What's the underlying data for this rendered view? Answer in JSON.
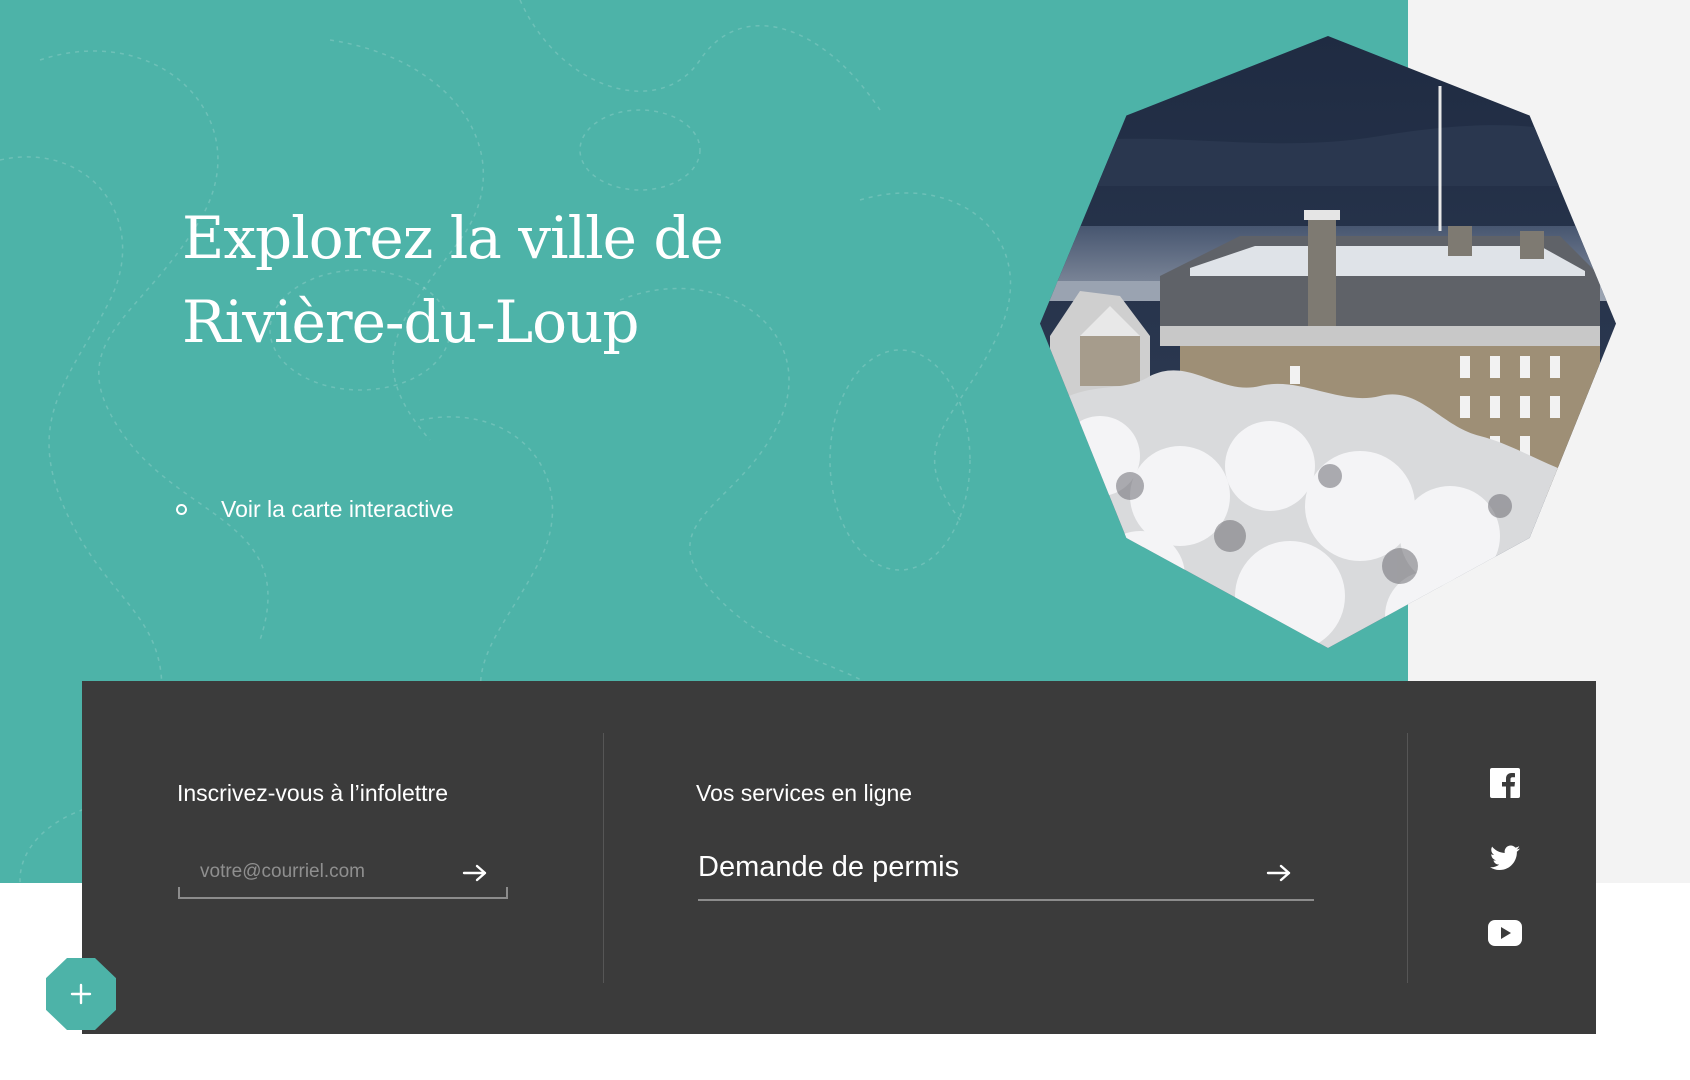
{
  "hero": {
    "title_line1": "Explorez la ville de",
    "title_line2": "Rivière-du-Loup",
    "map_link": "Voir la carte interactive"
  },
  "newsletter": {
    "title": "Inscrivez-vous à l’infolettre",
    "placeholder": "votre@courriel.com"
  },
  "services": {
    "title": "Vos services en ligne",
    "selected": "Demande de permis"
  },
  "social": {
    "items": [
      "facebook-icon",
      "twitter-icon",
      "youtube-icon"
    ]
  },
  "colors": {
    "teal": "#4db3a8",
    "dark_band": "#3b3b3b",
    "light_panel": "#f3f3f3"
  }
}
